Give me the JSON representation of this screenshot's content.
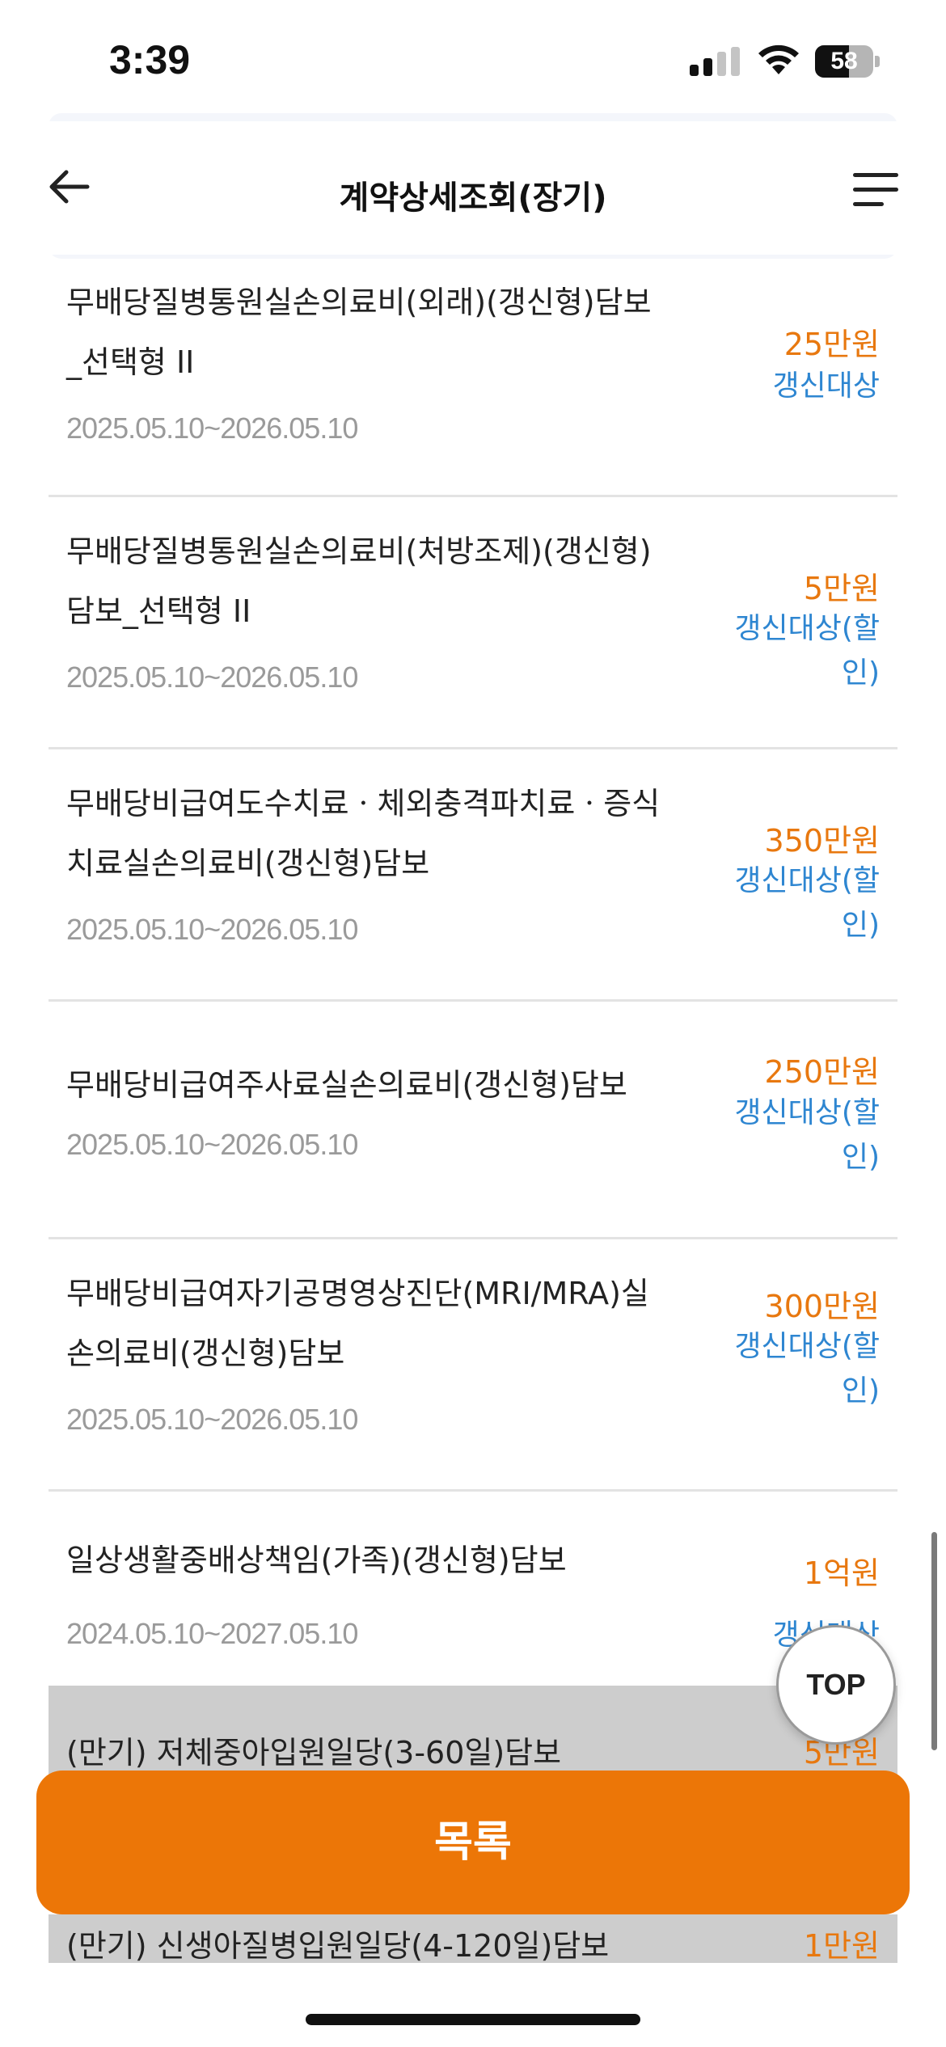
{
  "status_bar": {
    "time": "3:39",
    "battery": 58
  },
  "header": {
    "title": "계약상세조회(장기)"
  },
  "items": [
    {
      "title": "무배당질병통원실손의료비(외래)(갱신형)담보_선택형 II",
      "title_line1": "무배당질병통원실손의료비(외래)(갱신형)담보",
      "title_line2": "_선택형 II",
      "period": "2025.05.10~2026.05.10",
      "amount": "25만원",
      "status": "갱신대상"
    },
    {
      "title": "무배당질병통원실손의료비(처방조제)(갱신형)담보_선택형 II",
      "title_line1": "무배당질병통원실손의료비(처방조제)(갱신형)",
      "title_line2": "담보_선택형 II",
      "period": "2025.05.10~2026.05.10",
      "amount": "5만원",
      "status": "갱신대상(할인)",
      "status_line1": "갱신대상(할",
      "status_line2": "인)"
    },
    {
      "title": "무배당비급여도수치료ㆍ체외충격파치료ㆍ증식치료실손의료비(갱신형)담보",
      "title_line1": "무배당비급여도수치료ㆍ체외충격파치료ㆍ증식",
      "title_line2": "치료실손의료비(갱신형)담보",
      "period": "2025.05.10~2026.05.10",
      "amount": "350만원",
      "status": "갱신대상(할인)",
      "status_line1": "갱신대상(할",
      "status_line2": "인)"
    },
    {
      "title": "무배당비급여주사료실손의료비(갱신형)담보",
      "title_line1": "무배당비급여주사료실손의료비(갱신형)담보",
      "period": "2025.05.10~2026.05.10",
      "amount": "250만원",
      "status": "갱신대상(할인)",
      "status_line1": "갱신대상(할",
      "status_line2": "인)"
    },
    {
      "title": "무배당비급여자기공명영상진단(MRI/MRA)실손의료비(갱신형)담보",
      "title_line1": "무배당비급여자기공명영상진단(MRI/MRA)실",
      "title_line2": "손의료비(갱신형)담보",
      "period": "2025.05.10~2026.05.10",
      "amount": "300만원",
      "status": "갱신대상(할인)",
      "status_line1": "갱신대상(할",
      "status_line2": "인)"
    },
    {
      "title": "일상생활중배상책임(가족)(갱신형)담보",
      "title_line1": "일상생활중배상책임(가족)(갱신형)담보",
      "period": "2024.05.10~2027.05.10",
      "amount": "1억원",
      "status": "갱신대상"
    }
  ],
  "matured_items": [
    {
      "title": "(만기) 저체중아입원일당(3-60일)담보",
      "amount": "5만원"
    },
    {
      "title": "(만기) 신생아질병입원일당(4-120일)담보",
      "amount": "1만원"
    }
  ],
  "top_button": "TOP",
  "list_button": "목록"
}
